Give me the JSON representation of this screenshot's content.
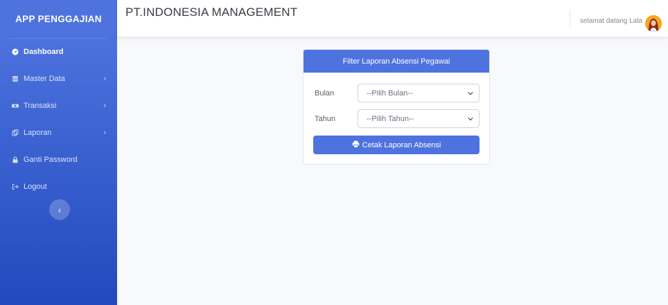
{
  "sidebar": {
    "brand": "APP PENGGAJIAN",
    "items": [
      {
        "label": "Dashboard",
        "icon": "tachometer-icon",
        "active": true
      },
      {
        "label": "Master Data",
        "icon": "database-icon",
        "chevron": "›"
      },
      {
        "label": "Transaksi",
        "icon": "money-icon",
        "chevron": "›"
      },
      {
        "label": "Laporan",
        "icon": "copy-icon",
        "chevron": "›"
      },
      {
        "label": "Ganti Password",
        "icon": "lock-icon"
      },
      {
        "label": "Logout",
        "icon": "sign-out-icon"
      }
    ],
    "toggle_glyph": "‹"
  },
  "topbar": {
    "company": "PT.INDONESIA MANAGEMENT",
    "greeting": "selamat datang Lala"
  },
  "filter_card": {
    "title": "Filter Laporan Absensi Pegawai",
    "bulan_label": "Bulan",
    "bulan_value": "--Pilih Bulan--",
    "tahun_label": "Tahun",
    "tahun_value": "--Pilih Tahun--",
    "print_button": "Cetak Laporan Absensi"
  },
  "colors": {
    "primary": "#4e73df",
    "sidebar_end": "#224abe",
    "background": "#f8f9fc"
  }
}
